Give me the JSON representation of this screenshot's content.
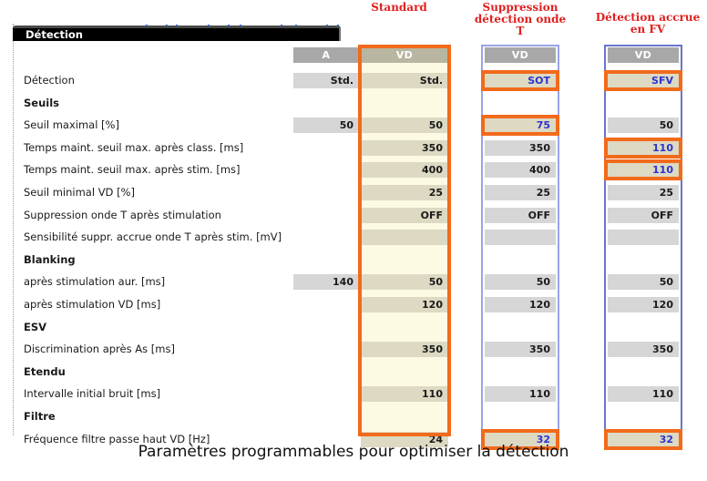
{
  "column_captions": {
    "standard": "Standard",
    "suppression_onde_t": "Suppression\ndétection onde\nT",
    "detection_accrue_fv": "Détection accrue\nen FV"
  },
  "panel": {
    "title": "Détection"
  },
  "columns": [
    {
      "key": "a",
      "header": "A"
    },
    {
      "key": "vd_std",
      "header": "VD"
    },
    {
      "key": "vd_sot",
      "header": "VD"
    },
    {
      "key": "vd_sfv",
      "header": "VD"
    }
  ],
  "rows": [
    {
      "label": "Détection",
      "type": "param",
      "a": "Std.",
      "vd_std": "Std.",
      "vd_sot": "SOT",
      "vd_sfv": "SFV"
    },
    {
      "label": "Seuils",
      "type": "section",
      "a": "",
      "vd_std": "",
      "vd_sot": "",
      "vd_sfv": ""
    },
    {
      "label": "Seuil maximal [%]",
      "type": "param",
      "a": "50",
      "vd_std": "50",
      "vd_sot": "75",
      "vd_sfv": "50"
    },
    {
      "label": "Temps maint. seuil max. après class. [ms]",
      "type": "param",
      "a": "",
      "vd_std": "350",
      "vd_sot": "350",
      "vd_sfv": "110"
    },
    {
      "label": "Temps maint. seuil max. après stim. [ms]",
      "type": "param",
      "a": "",
      "vd_std": "400",
      "vd_sot": "400",
      "vd_sfv": "110"
    },
    {
      "label": "Seuil minimal VD [%]",
      "type": "param",
      "a": "",
      "vd_std": "25",
      "vd_sot": "25",
      "vd_sfv": "25"
    },
    {
      "label": "Suppression onde T après stimulation",
      "type": "param",
      "a": "",
      "vd_std": "OFF",
      "vd_sot": "OFF",
      "vd_sfv": "OFF"
    },
    {
      "label": "Sensibilité suppr. accrue onde T après stim. [mV]",
      "type": "param",
      "a": "",
      "vd_std": "",
      "vd_sot": "",
      "vd_sfv": ""
    },
    {
      "label": "Blanking",
      "type": "section",
      "a": "",
      "vd_std": "",
      "vd_sot": "",
      "vd_sfv": ""
    },
    {
      "label": "après stimulation aur. [ms]",
      "type": "param",
      "a": "140",
      "vd_std": "50",
      "vd_sot": "50",
      "vd_sfv": "50"
    },
    {
      "label": "après stimulation VD [ms]",
      "type": "param",
      "a": "",
      "vd_std": "120",
      "vd_sot": "120",
      "vd_sfv": "120"
    },
    {
      "label": "ESV",
      "type": "section",
      "a": "",
      "vd_std": "",
      "vd_sot": "",
      "vd_sfv": ""
    },
    {
      "label": "Discrimination après As [ms]",
      "type": "param",
      "a": "",
      "vd_std": "350",
      "vd_sot": "350",
      "vd_sfv": "350"
    },
    {
      "label": "Etendu",
      "type": "section",
      "a": "",
      "vd_std": "",
      "vd_sot": "",
      "vd_sfv": ""
    },
    {
      "label": "Intervalle initial bruit [ms]",
      "type": "param",
      "a": "",
      "vd_std": "110",
      "vd_sot": "110",
      "vd_sfv": "110"
    },
    {
      "label": "Filtre",
      "type": "section",
      "a": "",
      "vd_std": "",
      "vd_sot": "",
      "vd_sfv": ""
    },
    {
      "label": "Fréquence filtre passe haut VD [Hz]",
      "type": "param",
      "a": "",
      "vd_std": "24",
      "vd_sot": "32",
      "vd_sfv": "32"
    }
  ],
  "highlighted_cells": [
    {
      "column": "vd_sot",
      "row": 0,
      "value": "SOT"
    },
    {
      "column": "vd_sfv",
      "row": 0,
      "value": "SFV"
    },
    {
      "column": "vd_sot",
      "row": 2,
      "value": "75"
    },
    {
      "column": "vd_sfv",
      "row": 3,
      "value": "110"
    },
    {
      "column": "vd_sfv",
      "row": 4,
      "value": "110"
    },
    {
      "column": "vd_sot",
      "row": 16,
      "value": "32"
    },
    {
      "column": "vd_sfv",
      "row": 16,
      "value": "32"
    }
  ],
  "figure_caption": "Paramètres programmables pour optimiser la détection",
  "colors": {
    "highlight_orange": "#f26a1b",
    "caption_red": "#e02020",
    "value_blue": "#2b35cf",
    "header_grey": "#a8a8a8",
    "cell_grey": "#d6d6d6",
    "cell_beige": "#ddd9c3",
    "column_cream": "#fdfae4",
    "titlebar_black": "#000000"
  }
}
